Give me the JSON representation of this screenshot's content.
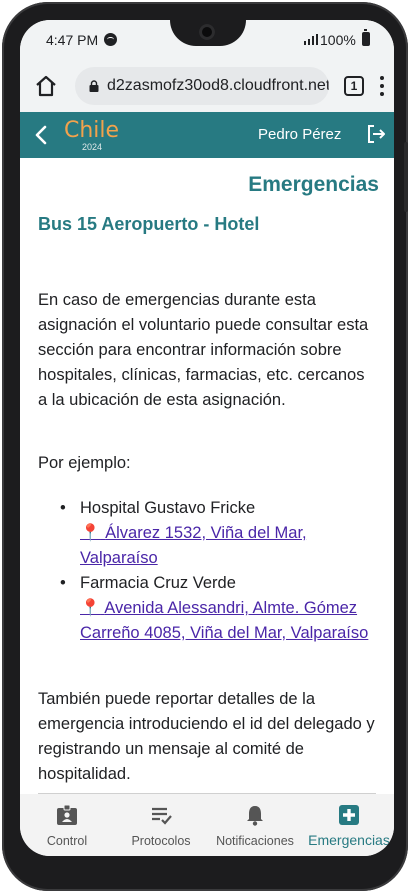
{
  "status_bar": {
    "time": "4:47 PM",
    "battery": "100%"
  },
  "browser": {
    "url": "d2zasmofz30od8.cloudfront.net",
    "tab_count": "1"
  },
  "header": {
    "logo": "Chile",
    "logo_year": "2024",
    "user_name": "Pedro Pérez"
  },
  "content": {
    "page_title": "Emergencias",
    "section_title": "Bus 15 Aeropuerto - Hotel",
    "intro": "En caso de emergencias durante esta asignación el voluntario puede consultar esta sección para encontrar información sobre hospitales, clínicas, farmacias, etc. cercanos a la ubicación de esta asignación.",
    "example_label": "Por ejemplo:",
    "places": [
      {
        "name": "Hospital Gustavo Fricke",
        "address": "Álvarez 1532, Viña del Mar, Valparaíso"
      },
      {
        "name": "Farmacia Cruz Verde",
        "address": "Avenida Alessandri, Almte. Gómez Carreño 4085, Viña del Mar, Valparaíso"
      }
    ],
    "outro": "También puede reportar detalles de la emergencia introduciendo el id del delegado y registrando un mensaje al comité de hospitalidad."
  },
  "nav": {
    "items": [
      {
        "label": "Control",
        "icon": "badge-icon"
      },
      {
        "label": "Protocolos",
        "icon": "checklist-icon"
      },
      {
        "label": "Notificaciones",
        "icon": "bell-icon"
      },
      {
        "label": "Emergencias",
        "icon": "medical-cross-icon"
      }
    ],
    "active": "Emergencias"
  },
  "colors": {
    "primary": "#277a82",
    "accent": "#f2a24c",
    "link": "#4a26a8"
  }
}
